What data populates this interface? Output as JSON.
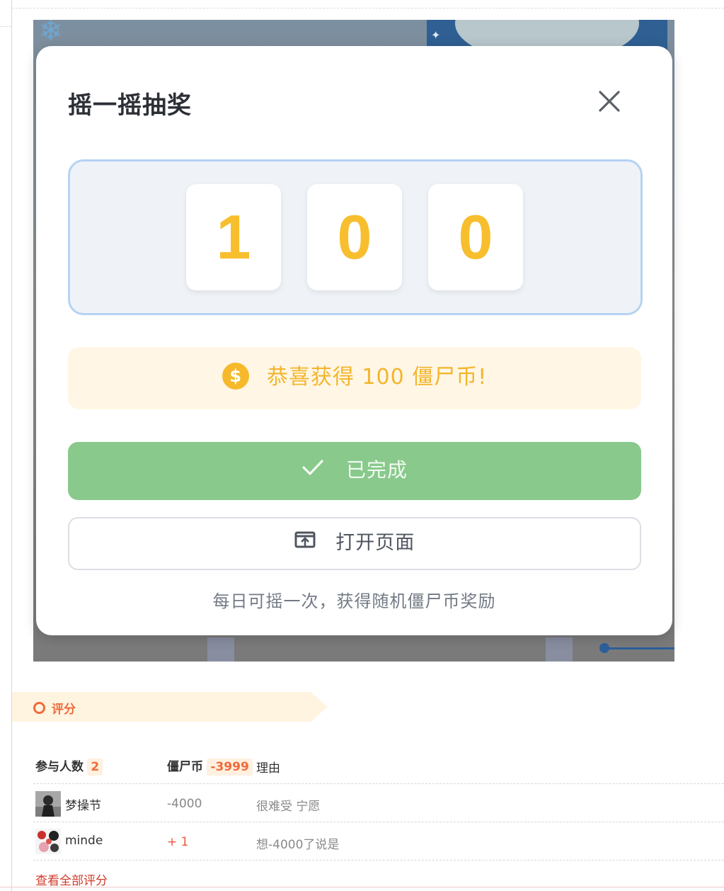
{
  "modal": {
    "title": "摇一摇抽奖",
    "digits": [
      "1",
      "0",
      "0"
    ],
    "prize_text": "恭喜获得 100 僵尸币!",
    "prize_icon_glyph": "$",
    "done_label": "已完成",
    "open_page_label": "打开页面",
    "hint": "每日可摇一次，获得随机僵尸币奖励",
    "colors": {
      "digit": "#f7be2e",
      "done_bg": "#89c98c",
      "prize_bg": "#fff6e5",
      "panel_border": "#b5d3f3"
    }
  },
  "rating": {
    "section_title": "评分",
    "participants_label": "参与人数",
    "participants_count": "2",
    "coin_label": "僵尸币",
    "coin_total": "-3999",
    "reason_label": "理由",
    "entries": [
      {
        "name": "梦操节",
        "coin": "-4000",
        "reason": "很难受 宁愿"
      },
      {
        "name": "minde",
        "coin": "+ 1",
        "reason": "想-4000了说是"
      }
    ],
    "view_all": "查看全部评分",
    "accent": "#f06a3c"
  }
}
